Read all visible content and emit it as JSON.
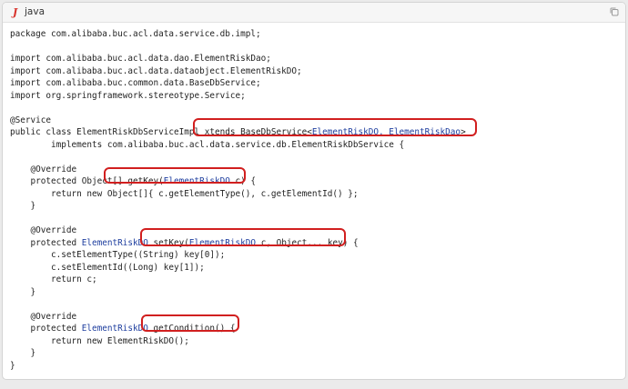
{
  "header": {
    "lang_icon": "J",
    "lang": "java",
    "copy_icon": "copy-icon"
  },
  "code": {
    "l1": "package com.alibaba.buc.acl.data.service.db.impl;",
    "l3": "import com.alibaba.buc.acl.data.dao.ElementRiskDao;",
    "l4": "import com.alibaba.buc.acl.data.dataobject.ElementRiskDO;",
    "l5": "import com.alibaba.buc.common.data.BaseDbService;",
    "l6": "import org.springframework.stereotype.Service;",
    "l8": "@Service",
    "l9a": "public class ElementRiskDbServiceImpl ",
    "l9b": "xtends BaseDbService<",
    "l9c": "ElementRiskDO, ElementRiskDao",
    "l9d": ">",
    "l10": "        implements com.alibaba.buc.acl.data.service.db.ElementRiskDbService {",
    "l12": "    @Override",
    "l13a": "    protected Object[] ",
    "l13b": "getKey(",
    "l13c": "ElementRiskDO",
    "l13d": " c) {",
    "l14": "        return new Object[]{ c.getElementType(), c.getElementId() };",
    "l15": "    }",
    "l17": "    @Override",
    "l18a": "    protected ",
    "l18b": "ElementRiskDO",
    "l18c": " setKey(",
    "l18d": "ElementRiskDO",
    "l18e": " c, Object... key) {",
    "l19": "        c.setElementType((String) key[0]);",
    "l20": "        c.setElementId((Long) key[1]);",
    "l21": "        return c;",
    "l22": "    }",
    "l24": "    @Override",
    "l25a": "    protected ",
    "l25b": "ElementRiskDO",
    "l25c": " getCondition() {",
    "l26": "        return new ElementRiskDO();",
    "l27": "    }",
    "l28": "}"
  },
  "colors": {
    "highlight": "#d11f1f",
    "type_blue": "#1d3d9e",
    "bracket_red": "#c22a1f"
  }
}
